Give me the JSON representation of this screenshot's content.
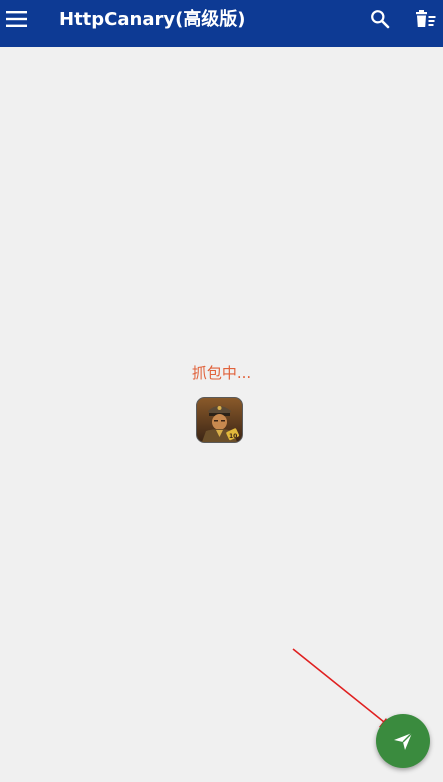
{
  "appbar": {
    "title": "HttpCanary(高级版)",
    "menu_icon": "hamburger-menu-icon",
    "search_icon": "search-icon",
    "clear_icon": "delete-list-icon",
    "background": "#0d3a94"
  },
  "main": {
    "status_text": "抓包中...",
    "status_color": "#e0613a",
    "target_app_icon": "game-app-icon"
  },
  "fab": {
    "icon": "send-icon",
    "color": "#3a8b3e"
  },
  "annotation": {
    "arrow_color": "#e02020"
  }
}
